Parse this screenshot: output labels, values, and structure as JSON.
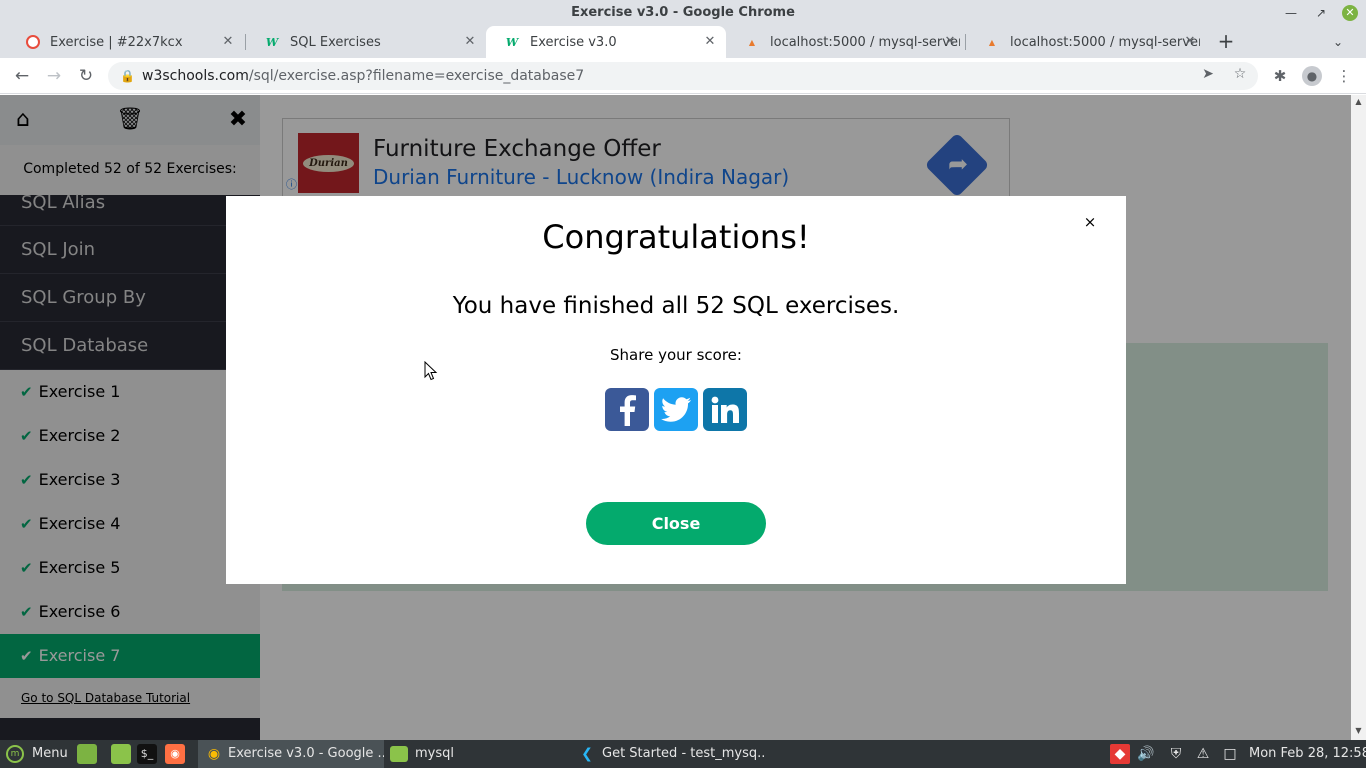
{
  "window": {
    "title": "Exercise v3.0 - Google Chrome"
  },
  "tabs": [
    {
      "label": "Exercise | #22x7kcx",
      "favicon": "circle-logo-icon"
    },
    {
      "label": "SQL Exercises",
      "favicon": "w3schools-icon"
    },
    {
      "label": "Exercise v3.0",
      "favicon": "w3schools-icon",
      "active": true
    },
    {
      "label": "localhost:5000 / mysql-server",
      "favicon": "phpmyadmin-icon"
    },
    {
      "label": "localhost:5000 / mysql-server",
      "favicon": "phpmyadmin-icon"
    }
  ],
  "address": {
    "domain": "w3schools.com",
    "path": "/sql/exercise.asp?filename=exercise_database7"
  },
  "sidebar": {
    "completed_text": "Completed 52 of 52 Exercises:",
    "sections": [
      "SQL Alias",
      "SQL Join",
      "SQL Group By",
      "SQL Database"
    ],
    "exercises": [
      "Exercise 1",
      "Exercise 2",
      "Exercise 3",
      "Exercise 4",
      "Exercise 5",
      "Exercise 6",
      "Exercise 7"
    ],
    "active_exercise": "Exercise 7",
    "tutorial_link": "Go to SQL Database Tutorial"
  },
  "ad": {
    "logo_text": "Durian",
    "headline": "Furniture Exchange Offer",
    "subline": "Durian Furniture - Lucknow (Indira Nagar)"
  },
  "modal": {
    "title": "Congratulations!",
    "message": "You have finished all 52 SQL exercises.",
    "share_label": "Share your score:",
    "close_label": "Close",
    "close_x": "×"
  },
  "taskbar": {
    "menu_label": "Menu",
    "windows": [
      "Exercise v3.0 - Google ...",
      "mysql",
      "Get Started - test_mysq..."
    ],
    "clock": "Mon Feb 28, 12:58"
  },
  "colors": {
    "accent_green": "#04aa6d",
    "sidebar_dark": "#282a35",
    "facebook": "#3b5998",
    "twitter": "#1da1f2",
    "linkedin": "#0e76a8"
  }
}
